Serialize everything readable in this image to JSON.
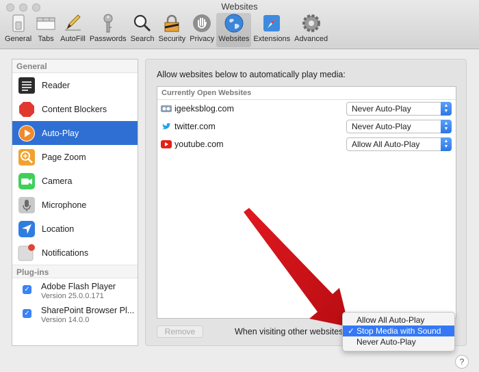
{
  "window": {
    "title": "Websites"
  },
  "toolbar": {
    "items": [
      {
        "label": "General",
        "icon": "switch-icon"
      },
      {
        "label": "Tabs",
        "icon": "tabs-icon"
      },
      {
        "label": "AutoFill",
        "icon": "pencil-icon"
      },
      {
        "label": "Passwords",
        "icon": "key-icon"
      },
      {
        "label": "Search",
        "icon": "magnifier-icon"
      },
      {
        "label": "Security",
        "icon": "lock-icon"
      },
      {
        "label": "Privacy",
        "icon": "hand-icon"
      },
      {
        "label": "Websites",
        "icon": "globe-icon",
        "active": true
      },
      {
        "label": "Extensions",
        "icon": "compass-icon"
      },
      {
        "label": "Advanced",
        "icon": "gear-icon"
      }
    ]
  },
  "sidebar": {
    "general_header": "General",
    "items": [
      {
        "label": "Reader"
      },
      {
        "label": "Content Blockers"
      },
      {
        "label": "Auto-Play",
        "selected": true
      },
      {
        "label": "Page Zoom"
      },
      {
        "label": "Camera"
      },
      {
        "label": "Microphone"
      },
      {
        "label": "Location"
      },
      {
        "label": "Notifications"
      }
    ],
    "plugins_header": "Plug-ins",
    "plugins": [
      {
        "name": "Adobe Flash Player",
        "version": "Version 25.0.0.171",
        "checked": true
      },
      {
        "name": "SharePoint Browser Pl...",
        "version": "Version 14.0.0",
        "checked": true
      }
    ]
  },
  "main": {
    "description": "Allow websites below to automatically play media:",
    "sites_header": "Currently Open Websites",
    "sites": [
      {
        "domain": "igeeksblog.com",
        "setting": "Never Auto-Play"
      },
      {
        "domain": "twitter.com",
        "setting": "Never Auto-Play"
      },
      {
        "domain": "youtube.com",
        "setting": "Allow All Auto-Play"
      }
    ],
    "remove_label": "Remove",
    "other_sites_label": "When visiting other websites",
    "dropdown_options": [
      {
        "label": "Allow All Auto-Play"
      },
      {
        "label": "Stop Media with Sound",
        "selected": true
      },
      {
        "label": "Never Auto-Play"
      }
    ],
    "help_label": "?"
  },
  "colors": {
    "selection": "#2f6fd3",
    "annotation_arrow": "#e0191f"
  }
}
